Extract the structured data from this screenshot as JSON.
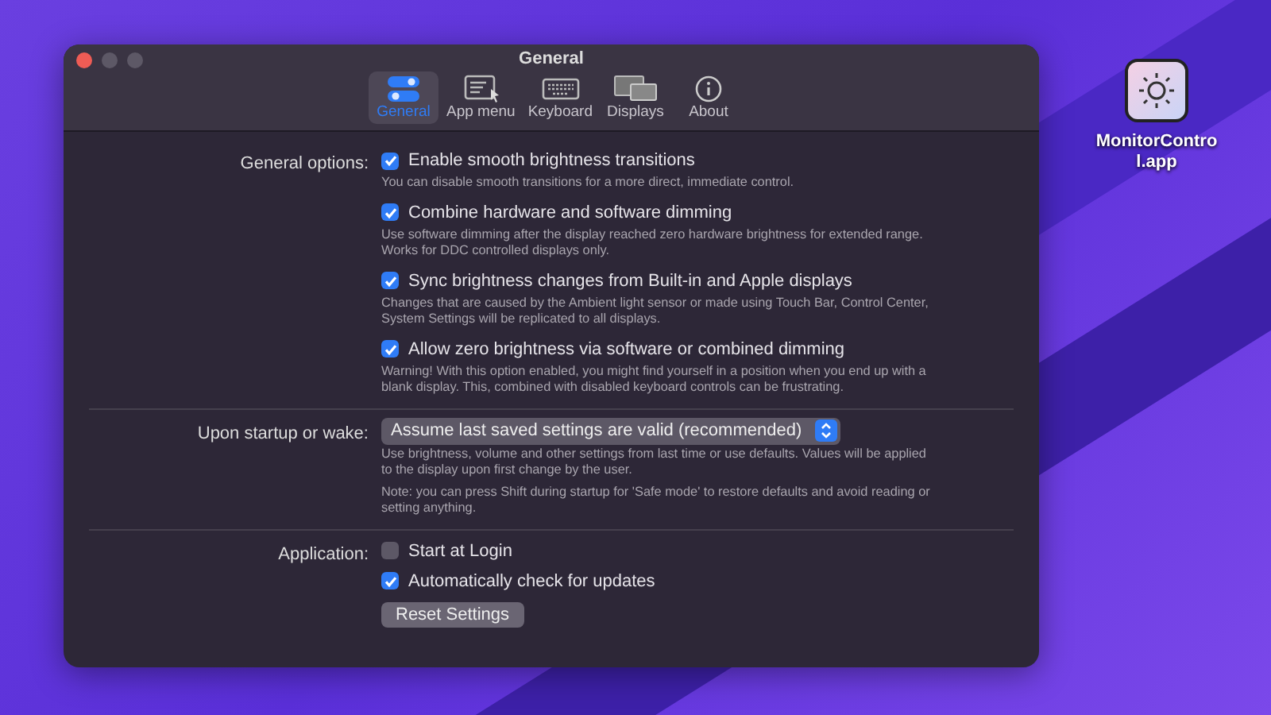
{
  "window": {
    "title": "General"
  },
  "tabs": [
    {
      "label": "General",
      "selected": true
    },
    {
      "label": "App menu",
      "selected": false
    },
    {
      "label": "Keyboard",
      "selected": false
    },
    {
      "label": "Displays",
      "selected": false
    },
    {
      "label": "About",
      "selected": false
    }
  ],
  "sections": [
    {
      "label": "General options:",
      "items": [
        {
          "kind": "checkbox",
          "label": "Enable smooth brightness transitions",
          "checked": true,
          "notes": [
            "You can disable smooth transitions for a more direct, immediate control."
          ]
        },
        {
          "kind": "checkbox",
          "label": "Combine hardware and software dimming",
          "checked": true,
          "notes": [
            "Use software dimming after the display reached zero hardware brightness for extended range. Works for DDC controlled displays only."
          ]
        },
        {
          "kind": "checkbox",
          "label": "Sync brightness changes from Built-in and Apple displays",
          "checked": true,
          "notes": [
            "Changes that are caused by the Ambient light sensor or made using Touch Bar, Control Center, System Settings will be replicated to all displays."
          ]
        },
        {
          "kind": "checkbox",
          "label": "Allow zero brightness via software or combined dimming",
          "checked": true,
          "notes": [
            "Warning! With this option enabled, you might find yourself in a position when you end up with a blank display. This, combined with disabled keyboard controls can be frustrating."
          ]
        }
      ]
    },
    {
      "label": "Upon startup or wake:",
      "items": [
        {
          "kind": "popup",
          "label": "Assume last saved settings are valid (recommended)",
          "notes": [
            "Use brightness, volume and other settings from last time or use defaults. Values will be applied to the display upon first change by the user.",
            "Note: you can press Shift during startup for 'Safe mode' to restore defaults and avoid reading or setting anything."
          ]
        }
      ]
    },
    {
      "label": "Application:",
      "items": [
        {
          "kind": "checkbox",
          "label": "Start at Login",
          "checked": false
        },
        {
          "kind": "checkbox",
          "label": "Automatically check for updates",
          "checked": true
        },
        {
          "kind": "button",
          "label": "Reset Settings"
        }
      ]
    }
  ],
  "desktop_icon": {
    "label": "MonitorControl.app"
  }
}
